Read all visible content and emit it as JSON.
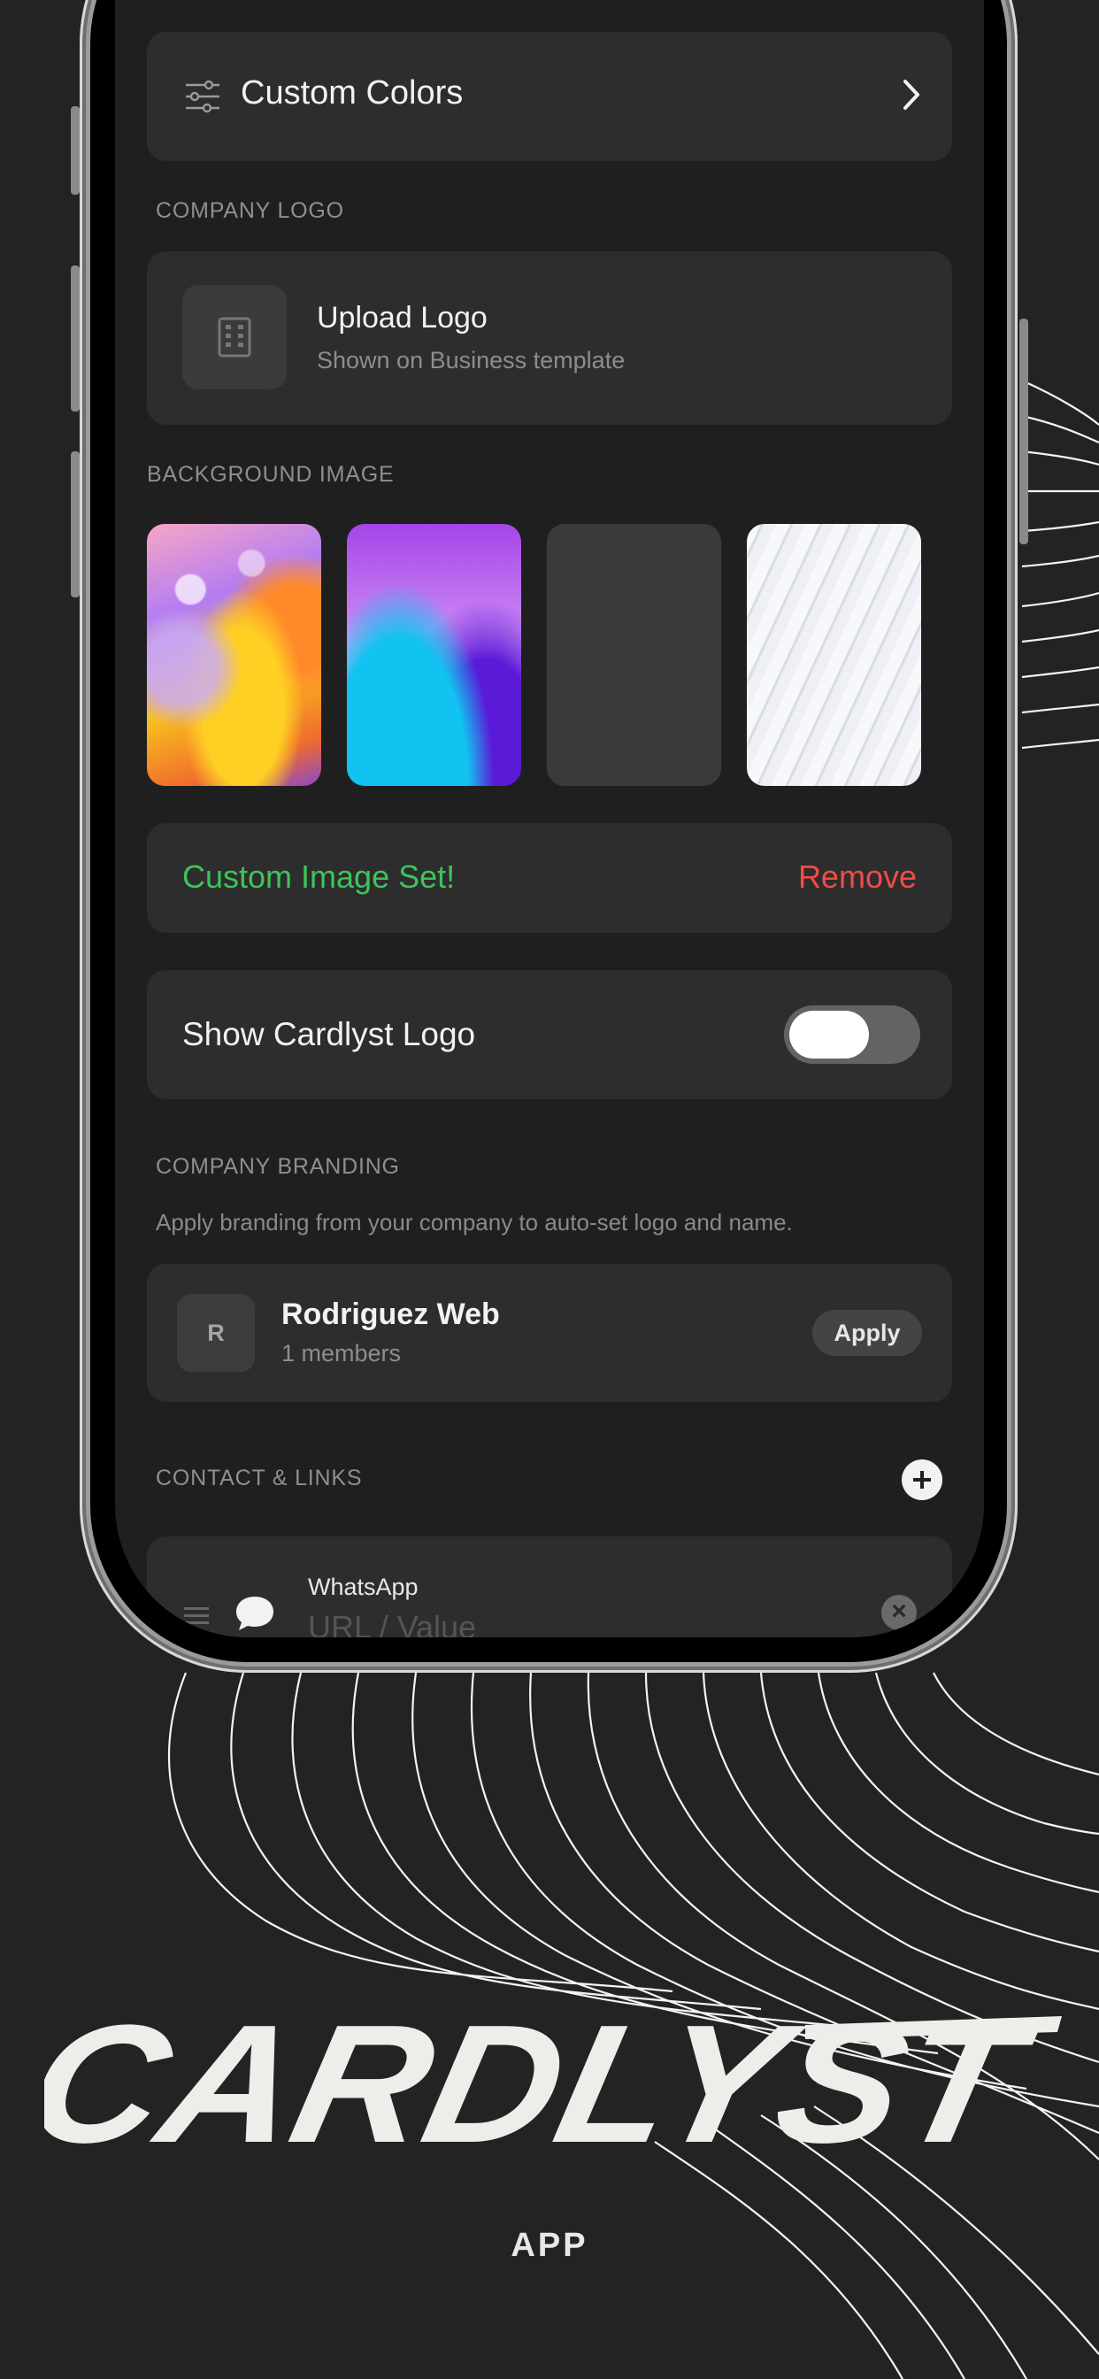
{
  "screen": {
    "custom_colors": {
      "label": "Custom Colors"
    },
    "company_logo": {
      "section_label": "COMPANY LOGO",
      "title": "Upload Logo",
      "subtitle": "Shown on Business template"
    },
    "background_image": {
      "section_label": "BACKGROUND IMAGE",
      "options": [
        "abstract-bubbles",
        "purple-blue-waves",
        "none",
        "white-waves"
      ]
    },
    "image_status": {
      "message": "Custom Image Set!",
      "remove_label": "Remove"
    },
    "show_logo": {
      "label": "Show Cardlyst Logo",
      "enabled": false
    },
    "company_branding": {
      "section_label": "COMPANY BRANDING",
      "description": "Apply branding from your company to auto-set logo and name.",
      "company_initial": "R",
      "company_name": "Rodriguez Web",
      "members": "1 members",
      "apply_label": "Apply"
    },
    "contact_links": {
      "section_label": "CONTACT & LINKS",
      "items": [
        {
          "type": "WhatsApp",
          "placeholder": "URL / Value"
        }
      ]
    }
  },
  "branding": {
    "wordmark": "CARDLYST",
    "subtitle": "APP"
  },
  "colors": {
    "background": "#232323",
    "card": "#2d2d2d",
    "success": "#3cc55b",
    "danger": "#f04c46"
  }
}
